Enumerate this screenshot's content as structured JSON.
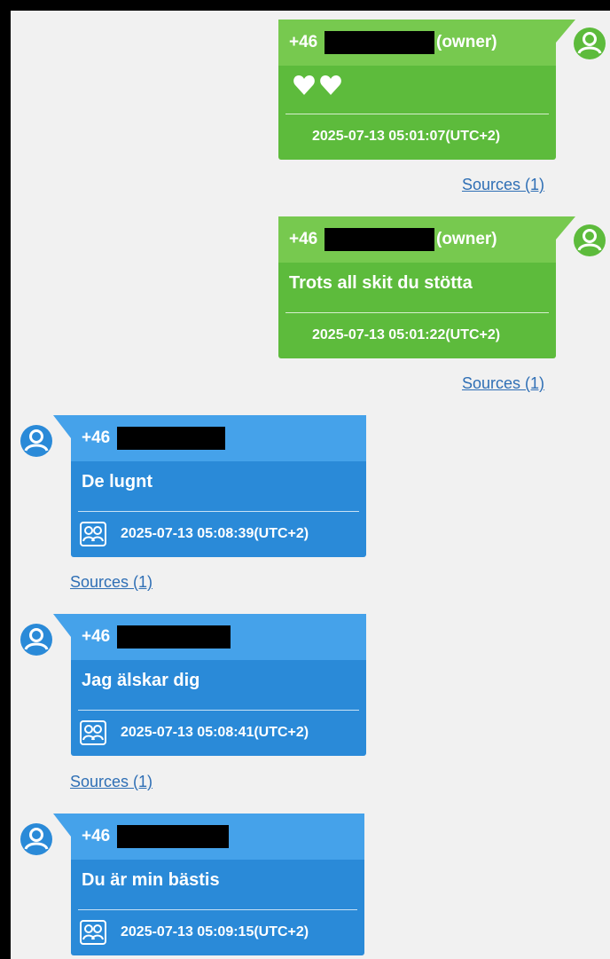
{
  "messages": [
    {
      "sender": "+46",
      "role": "(owner)",
      "text": "",
      "icon": "heart-icon heart-icon",
      "timestamp": "2025-07-13 05:01:07(UTC+2)",
      "sources": "Sources (1)"
    },
    {
      "sender": "+46",
      "role": "(owner)",
      "text": "Trots all skit du stötta",
      "timestamp": "2025-07-13 05:01:22(UTC+2)",
      "sources": "Sources (1)"
    },
    {
      "sender": "+46",
      "text": "De lugnt",
      "timestamp": "2025-07-13 05:08:39(UTC+2)",
      "sources": "Sources (1)"
    },
    {
      "sender": "+46",
      "text": "Jag älskar dig",
      "timestamp": "2025-07-13 05:08:41(UTC+2)",
      "sources": "Sources (1)"
    },
    {
      "sender": "+46",
      "text": "Du är min bästis",
      "timestamp": "2025-07-13 05:09:15(UTC+2)"
    }
  ],
  "colors": {
    "owner_bubble": "#5dbb3c",
    "owner_header": "#77c94f",
    "contact_bubble": "#2a8ad8",
    "contact_header": "#45a2ea",
    "link": "#2f6fb5"
  }
}
